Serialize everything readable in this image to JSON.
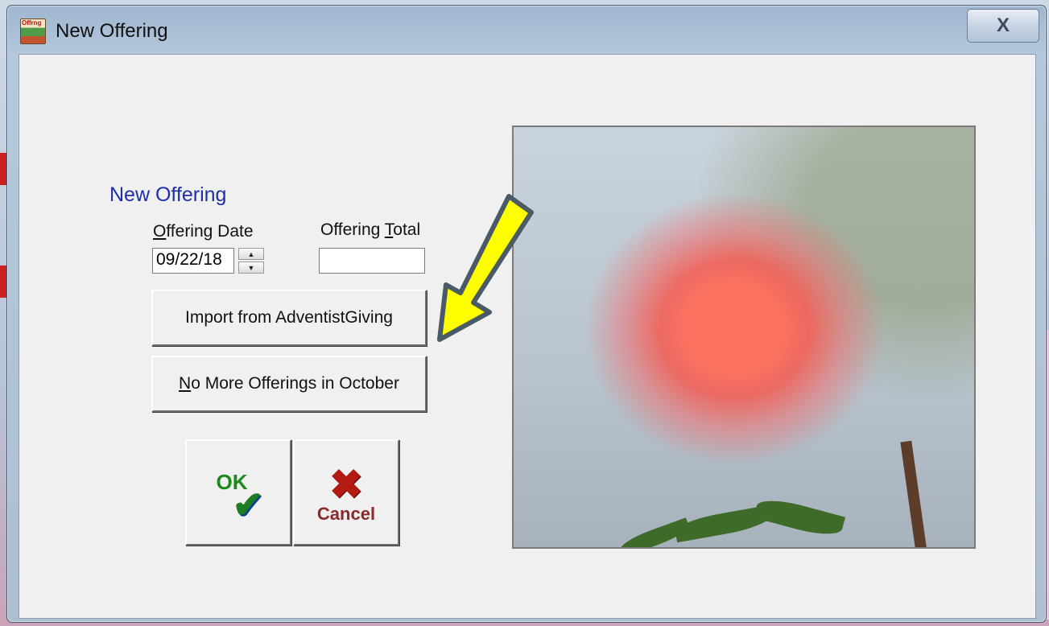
{
  "window": {
    "title": "New Offering",
    "close_label": "X",
    "app_icon_text": "Offrng"
  },
  "form": {
    "section_title": "New Offering",
    "date_label": "Offering Date",
    "date_value": "09/22/18",
    "total_label": "Offering Total",
    "total_value": "",
    "spin_up": "▲",
    "spin_down": "▼"
  },
  "buttons": {
    "import_label": "Import from AdventistGiving",
    "no_more_label": "No More Offerings in October",
    "ok_label": "OK",
    "ok_mark": "✔",
    "cancel_label": "Cancel",
    "cancel_mark": "✖"
  },
  "icons": {
    "app": "app-icon",
    "close": "close-icon",
    "ok": "checkmark-icon",
    "cancel": "x-icon",
    "annotation": "arrow-pointer"
  },
  "colors": {
    "section_title": "#1f2fa8",
    "ok_green": "#1d8a1d",
    "cancel_red": "#b21a12",
    "arrow_yellow": "#ffff00"
  }
}
